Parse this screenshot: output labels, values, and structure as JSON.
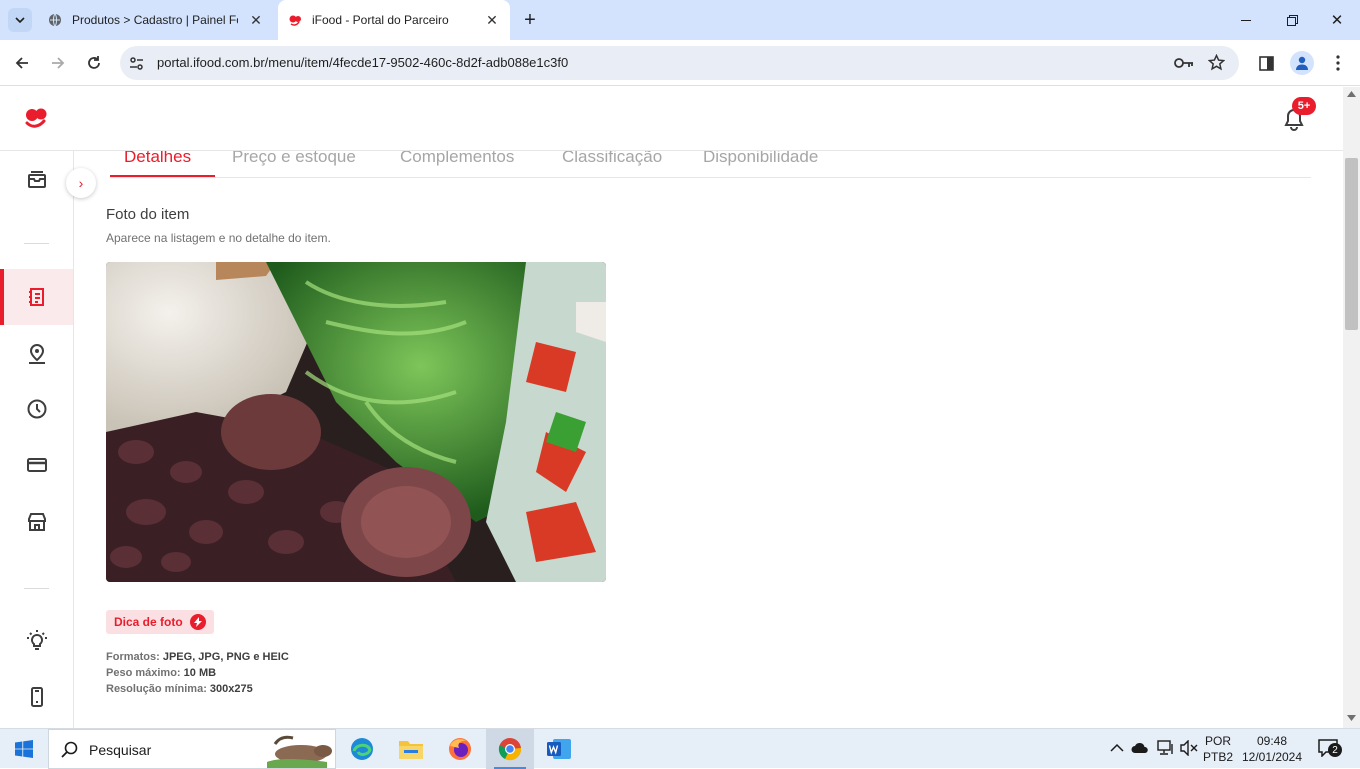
{
  "browser": {
    "tabs": [
      {
        "title": "Produtos > Cadastro | Painel Fo",
        "active": false
      },
      {
        "title": "iFood - Portal do Parceiro",
        "active": true
      }
    ],
    "url": "portal.ifood.com.br/menu/item/4fecde17-9502-460c-8d2f-adb088e1c3f0"
  },
  "header": {
    "notifications_badge": "5+"
  },
  "tabs": [
    {
      "label": "Detalhes",
      "active": true
    },
    {
      "label": "Preço e estoque",
      "active": false
    },
    {
      "label": "Complementos",
      "active": false
    },
    {
      "label": "Classificação",
      "active": false
    },
    {
      "label": "Disponibilidade",
      "active": false
    }
  ],
  "photo_section": {
    "title": "Foto do item",
    "subtitle": "Aparece na listagem e no detalhe do item.",
    "tip_label": "Dica de foto",
    "formats_label": "Formatos:",
    "formats_value": "JPEG, JPG, PNG e HEIC",
    "max_size_label": "Peso máximo:",
    "max_size_value": "10 MB",
    "min_resolution_label": "Resolução mínima:",
    "min_resolution_value": "300x275"
  },
  "taskbar": {
    "search_placeholder": "Pesquisar",
    "lang_top": "POR",
    "lang_bottom": "PTB2",
    "time": "09:48",
    "date": "12/01/2024",
    "notification_count": "2"
  },
  "colors": {
    "brand": "#ea1d2c",
    "chrome_tabstrip": "#d3e3fd",
    "tip_bg": "#fbe0e3"
  }
}
